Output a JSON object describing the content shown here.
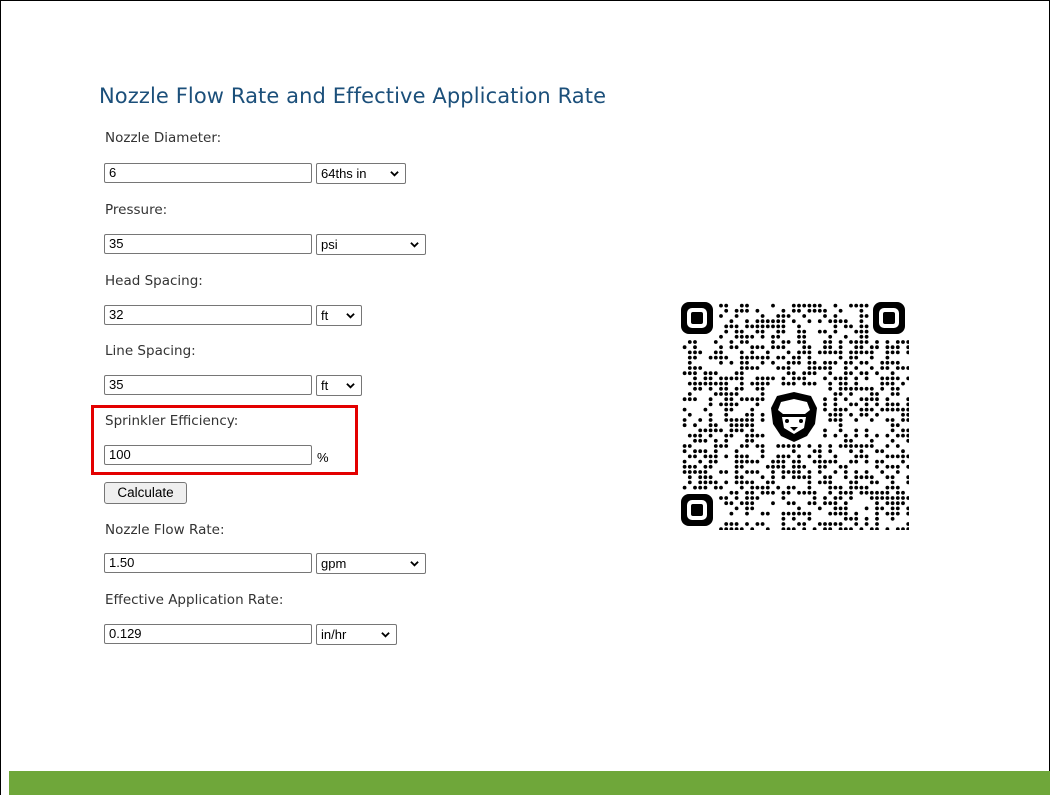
{
  "title": "Nozzle Flow Rate and Effective Application Rate",
  "fields": {
    "nozzle_diameter": {
      "label": "Nozzle Diameter:",
      "value": "6",
      "unit": "64ths in"
    },
    "pressure": {
      "label": "Pressure:",
      "value": "35",
      "unit": "psi"
    },
    "head_spacing": {
      "label": "Head Spacing:",
      "value": "32",
      "unit": "ft"
    },
    "line_spacing": {
      "label": "Line Spacing:",
      "value": "35",
      "unit": "ft"
    },
    "sprinkler_efficiency": {
      "label": "Sprinkler Efficiency:",
      "value": "100",
      "unit": "%"
    }
  },
  "calculate_label": "Calculate",
  "results": {
    "nozzle_flow_rate": {
      "label": "Nozzle Flow Rate:",
      "value": "1.50",
      "unit": "gpm"
    },
    "effective_application_rate": {
      "label": "Effective Application Rate:",
      "value": "0.129",
      "unit": "in/hr"
    }
  },
  "colors": {
    "title": "#1b4f7a",
    "highlight": "#e30000",
    "footer": "#6fa73a"
  },
  "icons": {
    "qr": "qr-code-icon",
    "dropdown": "chevron-down-icon"
  }
}
